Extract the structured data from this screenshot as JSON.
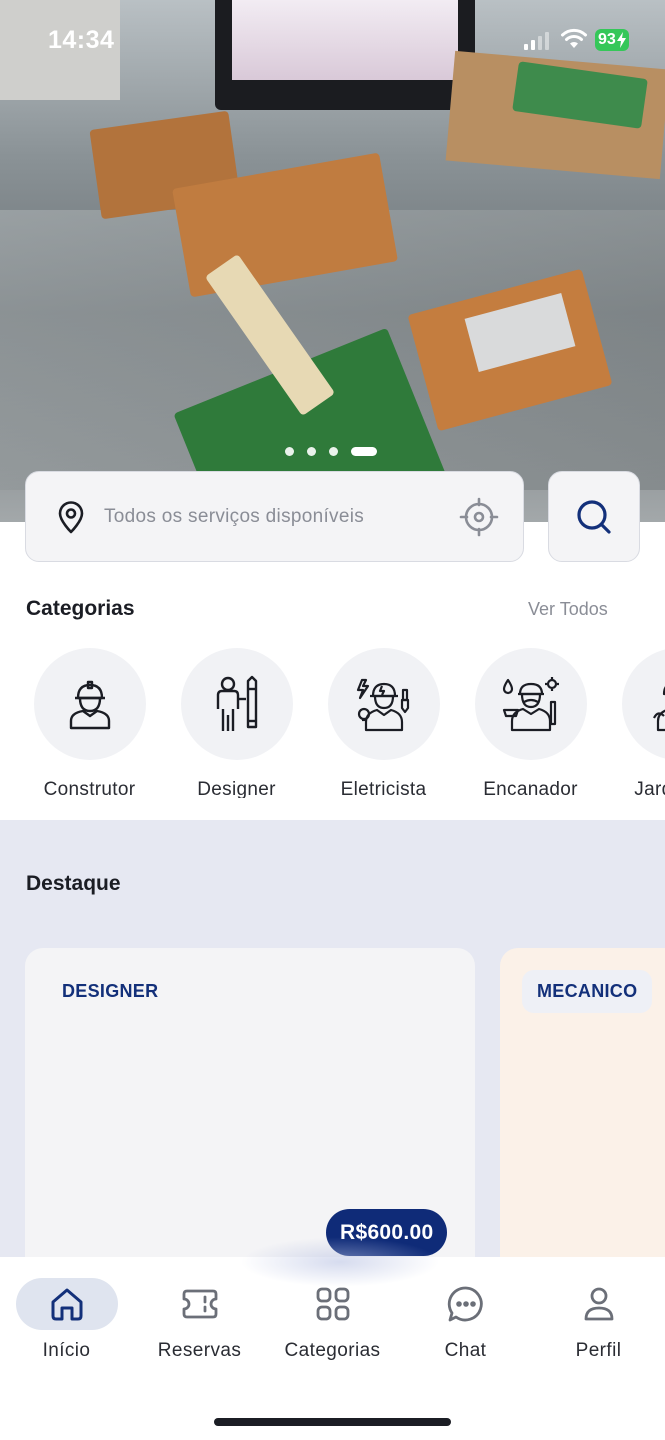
{
  "status_bar": {
    "time": "14:34",
    "battery": "93"
  },
  "carousel": {
    "dots": 4,
    "active_index": 3
  },
  "search": {
    "placeholder": "Todos os serviços disponíveis"
  },
  "categories": {
    "title": "Categorias",
    "see_all": "Ver Todos",
    "items": [
      {
        "label": "Construtor",
        "icon": "construction-worker-icon"
      },
      {
        "label": "Designer",
        "icon": "designer-icon"
      },
      {
        "label": "Eletricista",
        "icon": "electrician-icon"
      },
      {
        "label": "Encanador",
        "icon": "plumber-icon"
      },
      {
        "label": "Jardineiro",
        "icon": "gardener-icon"
      }
    ]
  },
  "featured": {
    "title": "Destaque",
    "cards": [
      {
        "tag": "DESIGNER",
        "price": "R$600.00"
      },
      {
        "tag": "MECANICO"
      }
    ]
  },
  "bottom_nav": {
    "items": [
      {
        "label": "Início",
        "icon": "home-icon",
        "active": true
      },
      {
        "label": "Reservas",
        "icon": "ticket-icon"
      },
      {
        "label": "Categorias",
        "icon": "grid-icon"
      },
      {
        "label": "Chat",
        "icon": "chat-icon"
      },
      {
        "label": "Perfil",
        "icon": "user-icon"
      }
    ]
  },
  "colors": {
    "primary": "#0f2b78",
    "active_nav_bg": "#dfe4ef",
    "featured_bg": "#e6e8f2"
  }
}
